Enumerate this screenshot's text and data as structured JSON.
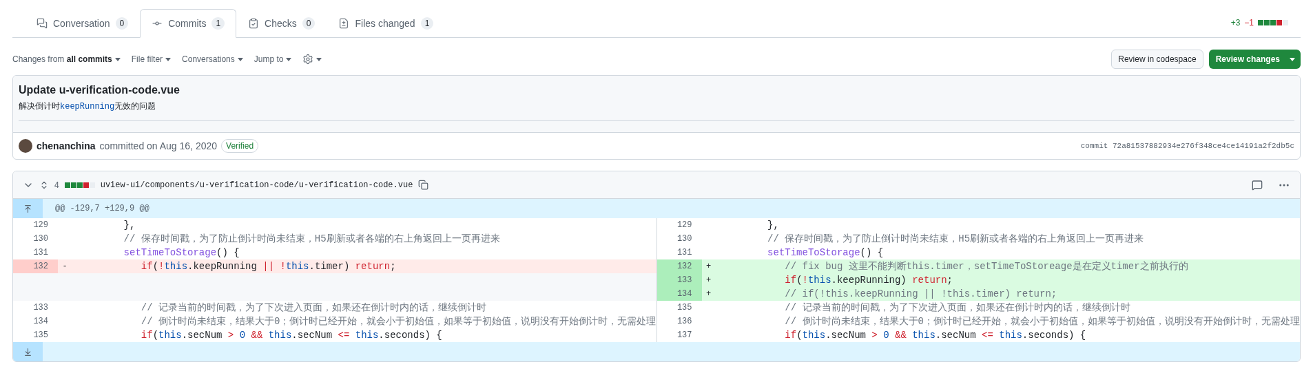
{
  "tabs": [
    {
      "label": "Conversation",
      "count": "0",
      "selected": false
    },
    {
      "label": "Commits",
      "count": "1",
      "selected": true
    },
    {
      "label": "Checks",
      "count": "0",
      "selected": false
    },
    {
      "label": "Files changed",
      "count": "1",
      "selected": false
    }
  ],
  "diffstat": {
    "additions": "+3",
    "deletions": "−1",
    "squares": [
      {
        "color": "#1f883d"
      },
      {
        "color": "#1f883d"
      },
      {
        "color": "#1f883d"
      },
      {
        "color": "#cf222e"
      },
      {
        "color": "#eaeef2"
      }
    ]
  },
  "toolbar": {
    "filters": [
      "Changes from **all commits**",
      "File filter",
      "Conversations",
      "Jump to"
    ],
    "buttons": [
      "Review in codespace",
      "Review changes"
    ]
  },
  "commit": {
    "title": "Update u-verification-code.vue",
    "message": [
      {
        "kind": "text",
        "text": "解决倒计时"
      },
      {
        "kind": "code",
        "text": "keepRunning"
      },
      {
        "kind": "text",
        "text": "无效的问题"
      }
    ],
    "author": "chenanchina",
    "action": "committed on Aug 16, 2020",
    "badge": "Verified",
    "sha": "commit 72a81537882934e276f348ce4ce14191a2f2db5c"
  },
  "file": {
    "changes": "4",
    "squares": [
      {
        "color": "#1f883d"
      },
      {
        "color": "#1f883d"
      },
      {
        "color": "#1f883d"
      },
      {
        "color": "#cf222e"
      },
      {
        "color": "#eaeef2"
      }
    ],
    "path": "uview-ui/components/u-verification-code/u-verification-code.vue",
    "hunk": "@@ -129,7 +129,9 @@",
    "rows": [
      {
        "left": {
          "kind": "context",
          "number": "129",
          "tokens": [
            {
              "kind": "text",
              "text": "         },"
            }
          ]
        },
        "right": {
          "kind": "context",
          "number": "129",
          "tokens": [
            {
              "kind": "text",
              "text": "         },"
            }
          ]
        }
      },
      {
        "left": {
          "kind": "context",
          "number": "130",
          "tokens": [
            {
              "kind": "comment",
              "text": "         // 保存时间戳，为了防止倒计时尚未结束，H5刷新或者各端的右上角返回上一页再进来"
            }
          ]
        },
        "right": {
          "kind": "context",
          "number": "130",
          "tokens": [
            {
              "kind": "comment",
              "text": "         // 保存时间戳，为了防止倒计时尚未结束，H5刷新或者各端的右上角返回上一页再进来"
            }
          ]
        }
      },
      {
        "left": {
          "kind": "context",
          "number": "131",
          "tokens": [
            {
              "kind": "entity",
              "text": "         setTimeToStorage"
            },
            {
              "kind": "text",
              "text": "() {"
            }
          ]
        },
        "right": {
          "kind": "context",
          "number": "131",
          "tokens": [
            {
              "kind": "entity",
              "text": "         setTimeToStorage"
            },
            {
              "kind": "text",
              "text": "() {"
            }
          ]
        }
      },
      {
        "left": {
          "kind": "deletion",
          "number": "132",
          "sign": "-",
          "tokens": [
            {
              "kind": "keyword",
              "text": "            if"
            },
            {
              "kind": "text",
              "text": "("
            },
            {
              "kind": "keyword",
              "text": "!"
            },
            {
              "kind": "constant",
              "text": "this"
            },
            {
              "kind": "text",
              "text": ".keepRunning "
            },
            {
              "kind": "keyword",
              "text": "||"
            },
            {
              "kind": "keyword",
              "text": " !"
            },
            {
              "kind": "constant",
              "text": "this"
            },
            {
              "kind": "text",
              "text": ".timer) "
            },
            {
              "kind": "keyword",
              "text": "return"
            },
            {
              "kind": "text",
              "text": ";"
            }
          ]
        },
        "right": {
          "kind": "addition",
          "number": "132",
          "sign": "+",
          "tokens": [
            {
              "kind": "comment",
              "text": "            // fix bug 这里不能判断this.timer，setTimeToStoreage是在定义timer之前执行的"
            }
          ]
        }
      },
      {
        "left": {
          "kind": "empty"
        },
        "right": {
          "kind": "addition",
          "number": "133",
          "sign": "+",
          "tokens": [
            {
              "kind": "keyword",
              "text": "            if"
            },
            {
              "kind": "text",
              "text": "("
            },
            {
              "kind": "keyword",
              "text": "!"
            },
            {
              "kind": "constant",
              "text": "this"
            },
            {
              "kind": "text",
              "text": ".keepRunning) "
            },
            {
              "kind": "keyword",
              "text": "return"
            },
            {
              "kind": "text",
              "text": ";"
            }
          ]
        }
      },
      {
        "left": {
          "kind": "empty"
        },
        "right": {
          "kind": "addition",
          "number": "134",
          "sign": "+",
          "tokens": [
            {
              "kind": "comment",
              "text": "            // if(!this.keepRunning || !this.timer) return;"
            }
          ]
        }
      },
      {
        "left": {
          "kind": "context",
          "number": "133",
          "tokens": [
            {
              "kind": "comment",
              "text": "            // 记录当前的时间戳，为了下次进入页面，如果还在倒计时内的话，继续倒计时"
            }
          ]
        },
        "right": {
          "kind": "context",
          "number": "135",
          "tokens": [
            {
              "kind": "comment",
              "text": "            // 记录当前的时间戳，为了下次进入页面，如果还在倒计时内的话，继续倒计时"
            }
          ]
        }
      },
      {
        "left": {
          "kind": "context",
          "number": "134",
          "tokens": [
            {
              "kind": "comment",
              "text": "            // 倒计时尚未结束，结果大于0；倒计时已经开始，就会小于初始值，如果等于初始值，说明没有开始倒计时，无需处理"
            }
          ]
        },
        "right": {
          "kind": "context",
          "number": "136",
          "tokens": [
            {
              "kind": "comment",
              "text": "            // 倒计时尚未结束，结果大于0；倒计时已经开始，就会小于初始值，如果等于初始值，说明没有开始倒计时，无需处理"
            }
          ]
        }
      },
      {
        "left": {
          "kind": "context",
          "number": "135",
          "tokens": [
            {
              "kind": "keyword",
              "text": "            if"
            },
            {
              "kind": "text",
              "text": "("
            },
            {
              "kind": "constant",
              "text": "this"
            },
            {
              "kind": "text",
              "text": ".secNum "
            },
            {
              "kind": "keyword",
              "text": ">"
            },
            {
              "kind": "constant",
              "text": " 0"
            },
            {
              "kind": "keyword",
              "text": " &&"
            },
            {
              "kind": "constant",
              "text": " this"
            },
            {
              "kind": "text",
              "text": ".secNum "
            },
            {
              "kind": "keyword",
              "text": "<="
            },
            {
              "kind": "constant",
              "text": " this"
            },
            {
              "kind": "text",
              "text": ".seconds) {"
            }
          ]
        },
        "right": {
          "kind": "context",
          "number": "137",
          "tokens": [
            {
              "kind": "keyword",
              "text": "            if"
            },
            {
              "kind": "text",
              "text": "("
            },
            {
              "kind": "constant",
              "text": "this"
            },
            {
              "kind": "text",
              "text": ".secNum "
            },
            {
              "kind": "keyword",
              "text": ">"
            },
            {
              "kind": "constant",
              "text": " 0"
            },
            {
              "kind": "keyword",
              "text": " &&"
            },
            {
              "kind": "constant",
              "text": " this"
            },
            {
              "kind": "text",
              "text": ".secNum "
            },
            {
              "kind": "keyword",
              "text": "<="
            },
            {
              "kind": "constant",
              "text": " this"
            },
            {
              "kind": "text",
              "text": ".seconds) {"
            }
          ]
        }
      }
    ]
  }
}
